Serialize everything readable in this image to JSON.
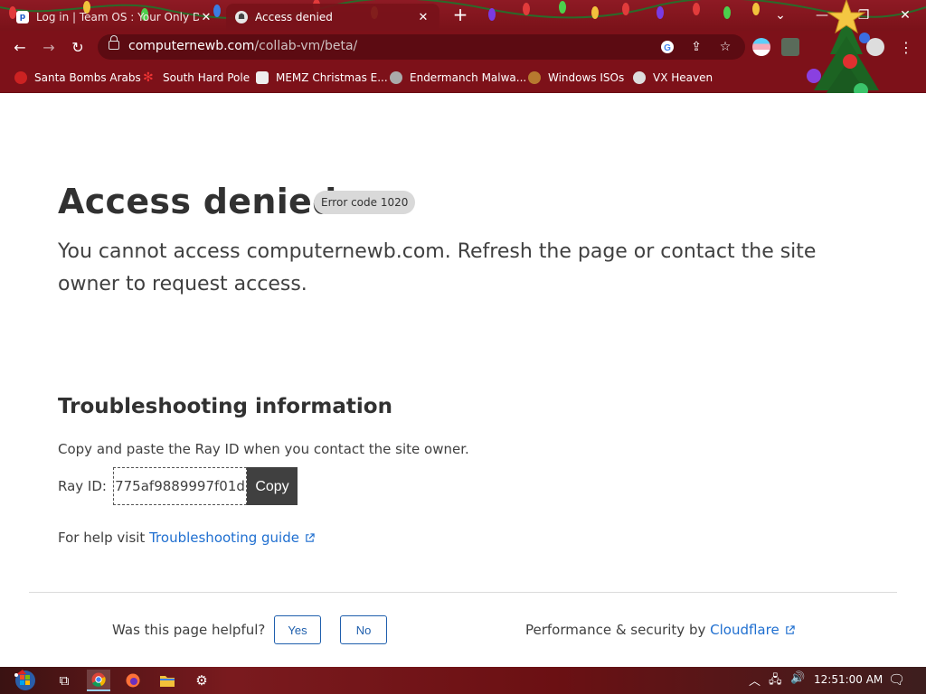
{
  "browser": {
    "tabs": [
      {
        "title": "Log in | Team OS : Your Only Destination",
        "favicon": "teamos-favicon",
        "active": false
      },
      {
        "title": "Access denied",
        "favicon": "computernewb-favicon",
        "active": true
      }
    ],
    "url_host": "computernewb.com",
    "url_path": "/collab-vm/beta/",
    "bookmarks": [
      {
        "label": "Santa Bombs Arabs",
        "icon": "santa-icon"
      },
      {
        "label": "South Hard Pole",
        "icon": "snowflake-icon"
      },
      {
        "label": "MEMZ Christmas E...",
        "icon": "memz-icon"
      },
      {
        "label": "Endermanch Malwa...",
        "icon": "raccoon-icon"
      },
      {
        "label": "Windows ISOs",
        "icon": "gingerbread-icon"
      },
      {
        "label": "VX Heaven",
        "icon": "vx-icon"
      }
    ],
    "accent": "#7d1119"
  },
  "page": {
    "title": "Access denied",
    "error_code": "Error code 1020",
    "lead": "You cannot access computernewb.com. Refresh the page or contact the site owner to request access.",
    "troubleshooting_heading": "Troubleshooting information",
    "copy_instruction": "Copy and paste the Ray ID when you contact the site owner.",
    "ray_label": "Ray ID:",
    "ray_id": "775af9889997f01d",
    "copy_label": "Copy",
    "help_prefix": "For help visit",
    "help_link": "Troubleshooting guide",
    "helpful_question": "Was this page helpful?",
    "yes_label": "Yes",
    "no_label": "No",
    "perf_prefix": "Performance & security by",
    "perf_link": "Cloudflare",
    "link_color": "#1f6fd0"
  },
  "taskbar": {
    "clock": "12:51:00 AM",
    "apps": [
      "start-orb",
      "task-view",
      "chrome",
      "firefox",
      "file-explorer",
      "settings"
    ]
  }
}
